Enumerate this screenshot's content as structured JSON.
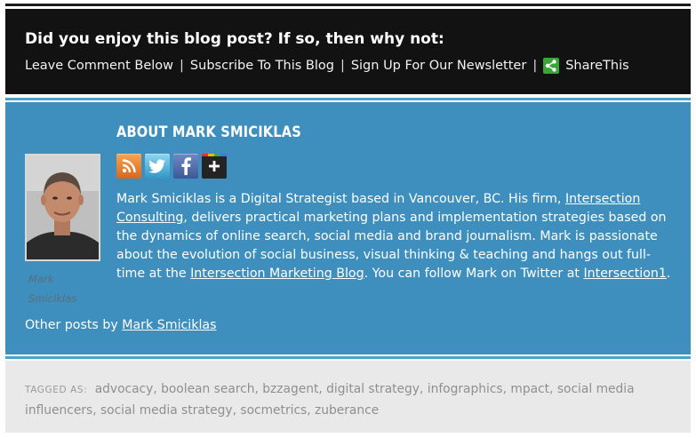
{
  "cta": {
    "title": "Did you enjoy this blog post? If so, then why not:",
    "links": [
      "Leave Comment Below",
      "Subscribe To This Blog",
      "Sign Up For Our Newsletter"
    ],
    "separator": "|",
    "share_label": "ShareThis"
  },
  "about": {
    "title": "ABOUT MARK SMICIKLAS",
    "author_caption_line1": "Mark",
    "author_caption_line2": "Smiciklas",
    "social_icons": [
      "rss-icon",
      "twitter-icon",
      "facebook-icon",
      "google-plus-icon"
    ],
    "bio": {
      "part1": "Mark Smiciklas is a Digital Strategist based in Vancouver, BC. His firm, ",
      "link1": "Intersection Consulting",
      "part2": ", delivers practical marketing plans and implementation strategies based on the dynamics of online search, social media and brand journalism. Mark is passionate about the evolution of social business, visual thinking & teaching and hangs out full-time at the ",
      "link2": "Intersection Marketing Blog",
      "part3": ". You can follow Mark on Twitter at ",
      "link3": "Intersection1",
      "part4": "."
    },
    "other_posts_prefix": "Other posts by ",
    "other_posts_link": "Mark Smiciklas"
  },
  "tags": {
    "label": "TAGGED AS:",
    "items": [
      "advocacy",
      "boolean search",
      "bzzagent",
      "digital strategy",
      "infographics",
      "mpact",
      "social media influencers",
      "social media strategy",
      "socmetrics",
      "zuberance"
    ]
  },
  "colors": {
    "cta_background": "#121212",
    "about_background": "#3e8fbe",
    "tags_background": "#e9e9e9",
    "share_green": "#3aa537"
  }
}
